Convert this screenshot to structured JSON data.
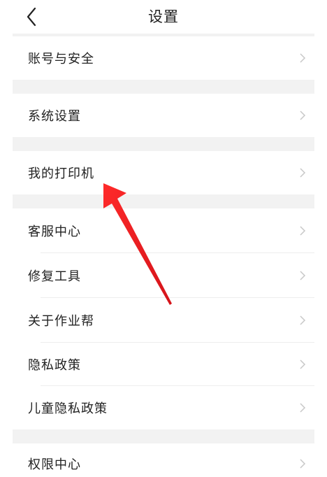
{
  "header": {
    "title": "设置",
    "back_icon": "chevron-left-icon"
  },
  "settings": {
    "group1": [
      {
        "label": "账号与安全"
      }
    ],
    "group2": [
      {
        "label": "系统设置"
      }
    ],
    "group3": [
      {
        "label": "我的打印机"
      }
    ],
    "group4": [
      {
        "label": "客服中心"
      },
      {
        "label": "修复工具"
      },
      {
        "label": "关于作业帮"
      },
      {
        "label": "隐私政策"
      },
      {
        "label": "儿童隐私政策"
      }
    ],
    "group5": [
      {
        "label": "权限中心"
      }
    ]
  },
  "colors": {
    "annotation_arrow": "#e8191b",
    "section_gap": "#f2f2f2",
    "chevron": "#c8c8c8"
  }
}
